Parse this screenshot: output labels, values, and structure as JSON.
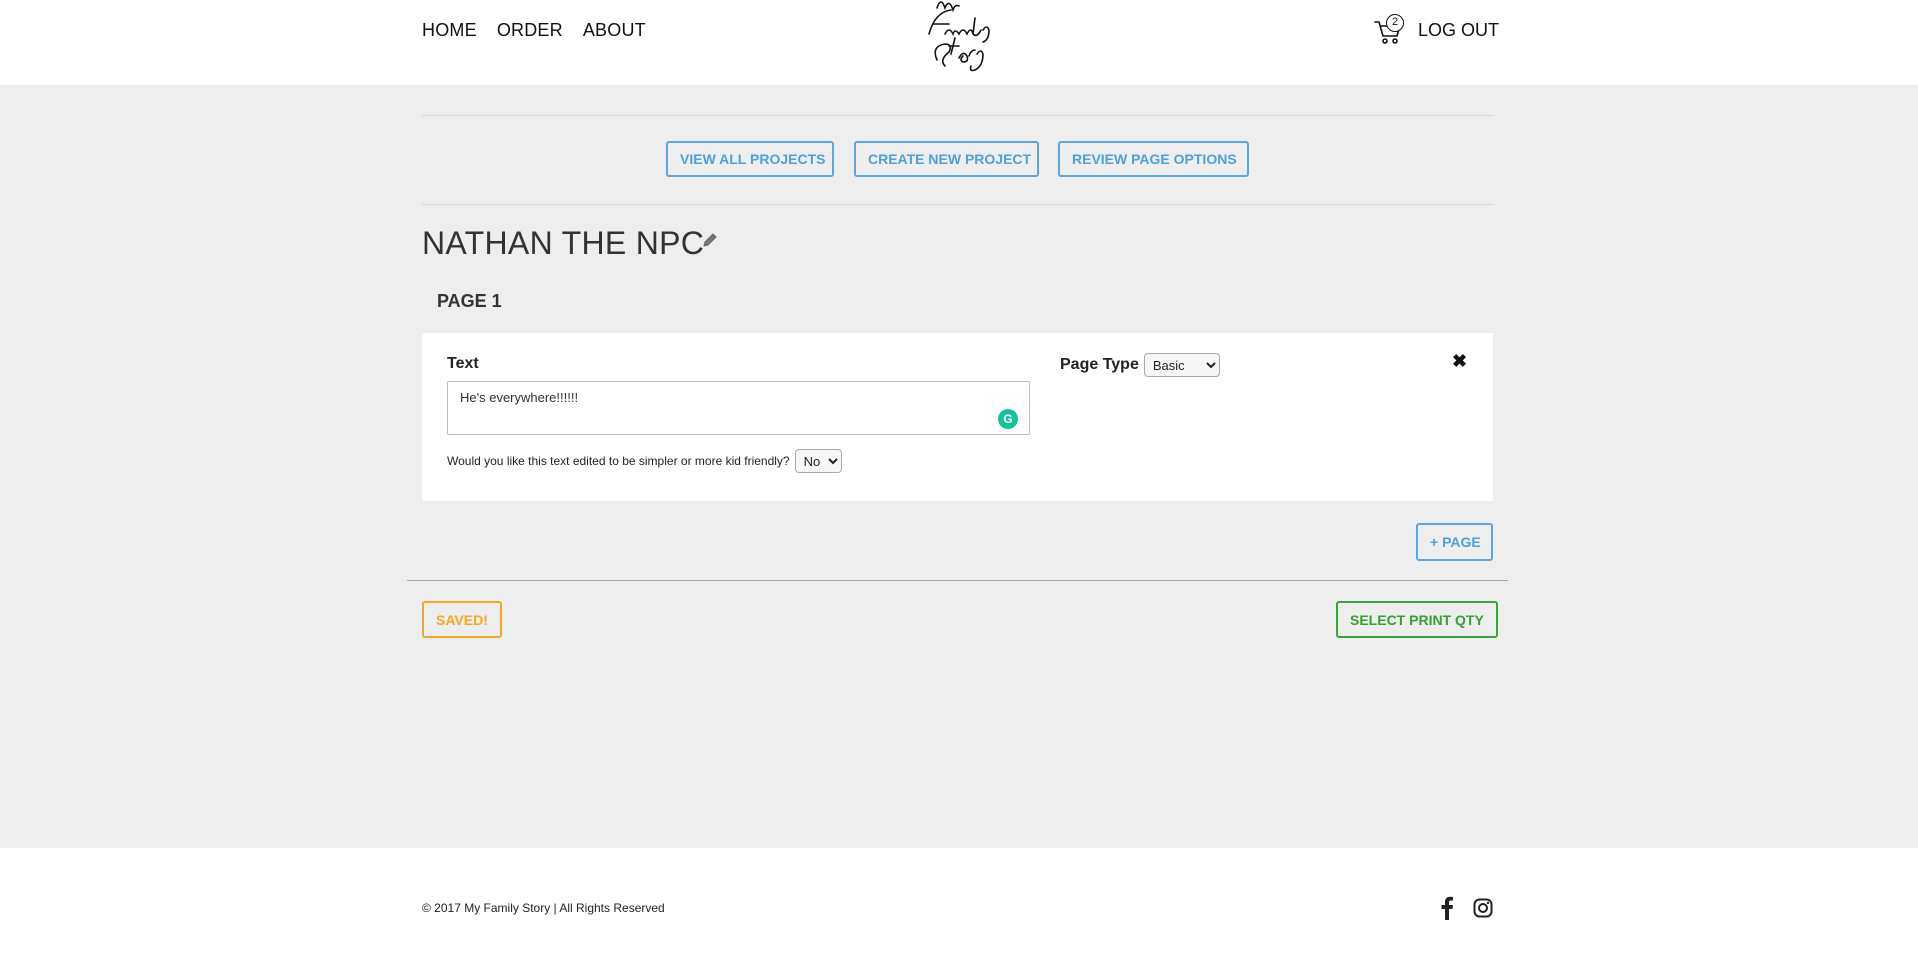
{
  "header": {
    "nav": [
      "HOME",
      "ORDER",
      "ABOUT"
    ],
    "logo_text": "My Family Story",
    "cart_count": "2",
    "logout_label": "LOG OUT"
  },
  "actions": {
    "view_all": "VIEW ALL PROJECTS",
    "create_new": "CREATE NEW PROJECT",
    "review_options": "REVIEW PAGE OPTIONS"
  },
  "project": {
    "title": "NATHAN THE NPC",
    "page_label": "PAGE 1",
    "text_label": "Text",
    "text_value": "He's everywhere!!!!!!",
    "simplify_question": "Would you like this text edited to be simpler or more kid friendly?",
    "simplify_value": "No",
    "page_type_label": "Page Type",
    "page_type_value": "Basic",
    "close_symbol": "✖"
  },
  "buttons": {
    "add_page": "+ PAGE",
    "saved": "SAVED!",
    "select_print": "SELECT PRINT QTY"
  },
  "footer": {
    "copyright": "© 2017 My Family Story | All Rights Reserved"
  },
  "colors": {
    "accent_blue": "#5ba6dd",
    "saved_orange": "#f5a623",
    "print_green": "#3aa53a",
    "background_gray": "#eeeeee"
  },
  "icons": [
    "cart-icon",
    "pencil-icon",
    "close-icon",
    "grammarly-icon",
    "facebook-icon",
    "instagram-icon"
  ]
}
